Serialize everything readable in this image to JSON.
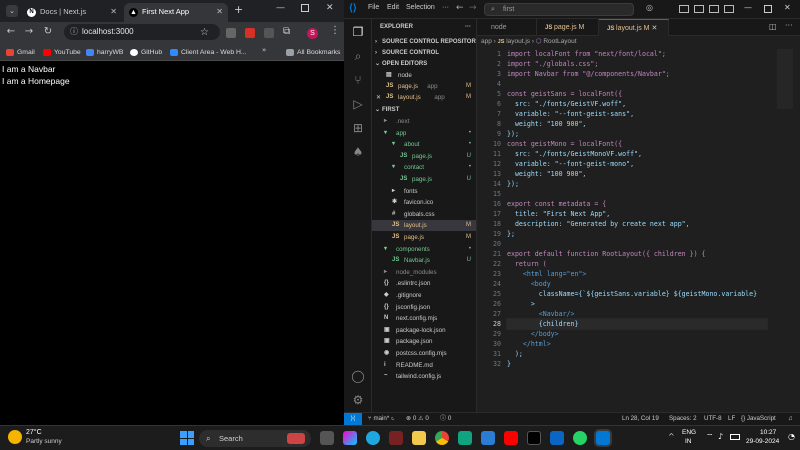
{
  "browser": {
    "tabs": [
      {
        "label": "Docs | Next.js",
        "active": false
      },
      {
        "label": "First Next App",
        "active": true
      }
    ],
    "new_tab": "+",
    "url": "localhost:3000",
    "bookmarks": [
      {
        "label": "Gmail",
        "color": "#ea4335"
      },
      {
        "label": "YouTube",
        "color": "#ff0000"
      },
      {
        "label": "harryWB",
        "color": "#4285f4"
      },
      {
        "label": "GitHub",
        "color": "#ffffff"
      },
      {
        "label": "Client Area - Web H...",
        "color": "#2e8bff"
      }
    ],
    "all_bookmarks": "All Bookmarks",
    "page_lines": [
      "I am a Navbar",
      "I am a Homepage"
    ],
    "profile_initial": "S"
  },
  "vscode": {
    "menu": [
      "File",
      "Edit",
      "Selection"
    ],
    "menu_more": "···",
    "command_center": "first",
    "explorer_title": "EXPLORER",
    "sections": {
      "source_control_repos": "SOURCE CONTROL REPOSITOR...",
      "source_control": "SOURCE CONTROL",
      "open_editors": "OPEN EDITORS",
      "project": "FIRST"
    },
    "open_editors": [
      {
        "label": "node",
        "icon": "▤",
        "color": "#cccccc",
        "status": "",
        "path": ""
      },
      {
        "label": "page.js",
        "icon": "JS",
        "color": "#e2c08d",
        "status": "M",
        "path": "app"
      },
      {
        "label": "layout.js",
        "icon": "JS",
        "color": "#e2c08d",
        "status": "M",
        "path": "app"
      }
    ],
    "tree": [
      {
        "label": ".next",
        "indent": 1,
        "icon": "▸",
        "color": "#8b8b8b",
        "status": ""
      },
      {
        "label": "app",
        "indent": 1,
        "icon": "▾",
        "color": "#73c991",
        "status": "•"
      },
      {
        "label": "about",
        "indent": 2,
        "icon": "▾",
        "color": "#73c991",
        "status": "•"
      },
      {
        "label": "page.js",
        "indent": 3,
        "icon": "JS",
        "color": "#73c991",
        "status": "U"
      },
      {
        "label": "contact",
        "indent": 2,
        "icon": "▾",
        "color": "#73c991",
        "status": "•"
      },
      {
        "label": "page.js",
        "indent": 3,
        "icon": "JS",
        "color": "#73c991",
        "status": "U"
      },
      {
        "label": "fonts",
        "indent": 2,
        "icon": "▸",
        "color": "#cccccc",
        "status": ""
      },
      {
        "label": "favicon.ico",
        "indent": 2,
        "icon": "✱",
        "color": "#cccccc",
        "status": ""
      },
      {
        "label": "globals.css",
        "indent": 2,
        "icon": "#",
        "color": "#cccccc",
        "status": ""
      },
      {
        "label": "layout.js",
        "indent": 2,
        "icon": "JS",
        "color": "#e2c08d",
        "status": "M",
        "selected": true
      },
      {
        "label": "page.js",
        "indent": 2,
        "icon": "JS",
        "color": "#e2c08d",
        "status": "M"
      },
      {
        "label": "components",
        "indent": 1,
        "icon": "▾",
        "color": "#73c991",
        "status": "•"
      },
      {
        "label": "Navbar.js",
        "indent": 2,
        "icon": "JS",
        "color": "#73c991",
        "status": "U"
      },
      {
        "label": "node_modules",
        "indent": 1,
        "icon": "▸",
        "color": "#8b8b8b",
        "status": ""
      },
      {
        "label": ".eslintrc.json",
        "indent": 1,
        "icon": "{}",
        "color": "#cccccc",
        "status": ""
      },
      {
        "label": ".gitignore",
        "indent": 1,
        "icon": "◆",
        "color": "#cccccc",
        "status": ""
      },
      {
        "label": "jsconfig.json",
        "indent": 1,
        "icon": "{}",
        "color": "#cccccc",
        "status": ""
      },
      {
        "label": "next.config.mjs",
        "indent": 1,
        "icon": "N",
        "color": "#cccccc",
        "status": ""
      },
      {
        "label": "package-lock.json",
        "indent": 1,
        "icon": "▣",
        "color": "#cccccc",
        "status": ""
      },
      {
        "label": "package.json",
        "indent": 1,
        "icon": "▣",
        "color": "#cccccc",
        "status": ""
      },
      {
        "label": "postcss.config.mjs",
        "indent": 1,
        "icon": "◉",
        "color": "#cccccc",
        "status": ""
      },
      {
        "label": "README.md",
        "indent": 1,
        "icon": "i",
        "color": "#cccccc",
        "status": ""
      },
      {
        "label": "tailwind.config.js",
        "indent": 1,
        "icon": "~",
        "color": "#cccccc",
        "status": ""
      }
    ],
    "editor_tabs": [
      {
        "label": "node",
        "status": "",
        "active": false
      },
      {
        "label": "page.js",
        "status": "M",
        "active": false
      },
      {
        "label": "layout.js",
        "status": "M",
        "active": true
      }
    ],
    "breadcrumb": [
      "app",
      "layout.js",
      "RootLayout"
    ],
    "code_lines": [
      "import localFont from \"next/font/local\";",
      "import \"./globals.css\";",
      "import Navbar from \"@/components/Navbar\";",
      "",
      "const geistSans = localFont({",
      "  src: \"./fonts/GeistVF.woff\",",
      "  variable: \"--font-geist-sans\",",
      "  weight: \"100 900\",",
      "});",
      "const geistMono = localFont({",
      "  src: \"./fonts/GeistMonoVF.woff\",",
      "  variable: \"--font-geist-mono\",",
      "  weight: \"100 900\",",
      "});",
      "",
      "export const metadata = {",
      "  title: \"First Next App\",",
      "  description: \"Generated by create next app\",",
      "};",
      "",
      "export default function RootLayout({ children }) {",
      "  return (",
      "    <html lang=\"en\">",
      "      <body",
      "        className={`${geistSans.variable} ${geistMono.variable}",
      "      >",
      "        <Navbar/>",
      "        {children}",
      "      </body>",
      "    </html>",
      "  );",
      "}"
    ],
    "current_line": 28,
    "status": {
      "branch": "main*",
      "errors": "0",
      "warnings": "0",
      "info": "0",
      "position": "Ln 28, Col 19",
      "spaces": "Spaces: 2",
      "encoding": "UTF-8",
      "eol": "LF",
      "language": "{} JavaScript"
    }
  },
  "taskbar": {
    "weather_temp": "27°C",
    "weather_desc": "Partly sunny",
    "search_placeholder": "Search",
    "lang": "ENG",
    "region": "IN",
    "time": "10:27",
    "date": "29-09-2024"
  }
}
